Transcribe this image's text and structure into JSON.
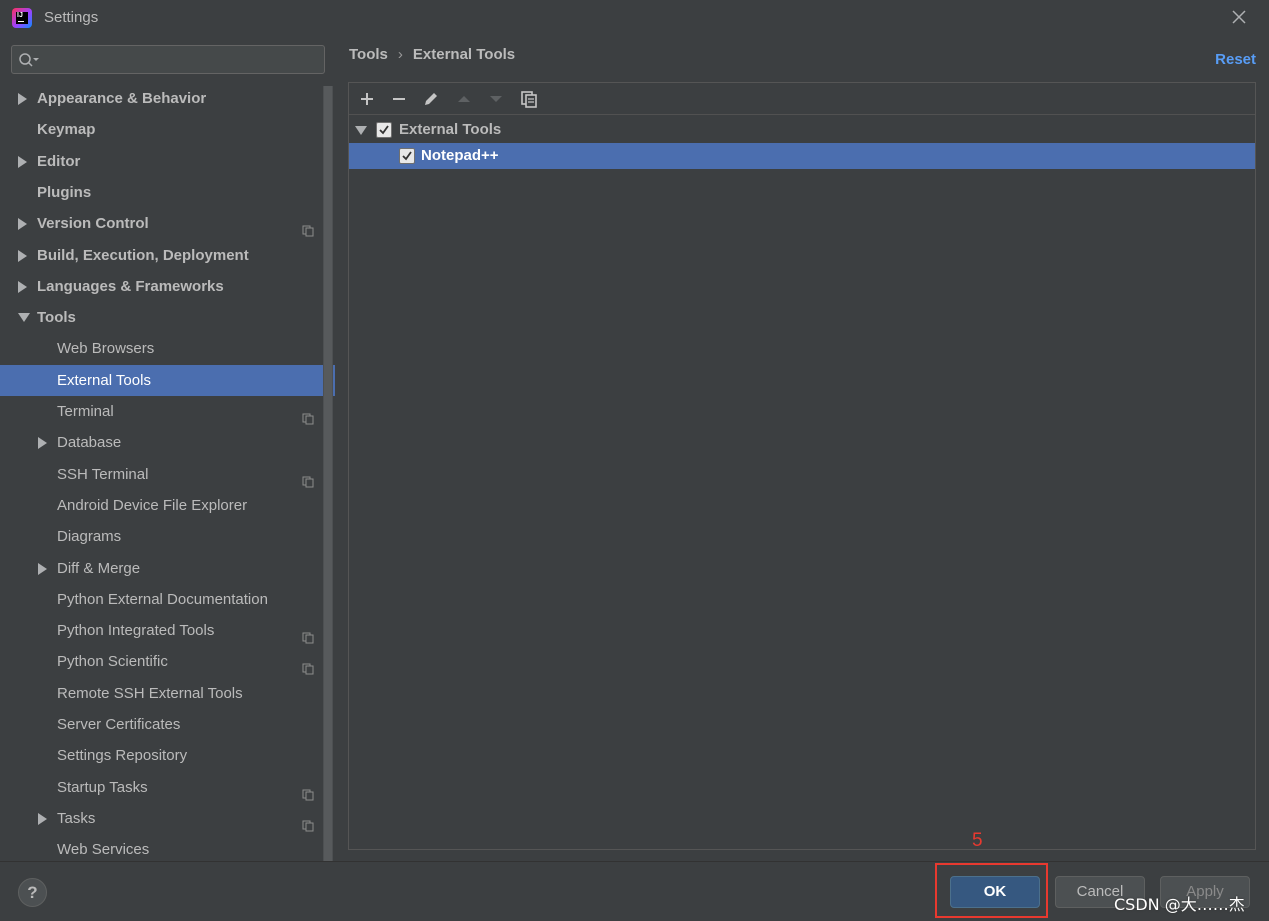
{
  "window": {
    "title": "Settings",
    "app_icon_text": "IJ"
  },
  "sidebar": {
    "search_placeholder": "",
    "items": [
      {
        "label": "Appearance & Behavior",
        "level": 0,
        "expandable": true,
        "expanded": false,
        "bold": true,
        "has_copy_icon": false
      },
      {
        "label": "Keymap",
        "level": 0,
        "expandable": false,
        "bold": true,
        "has_copy_icon": false
      },
      {
        "label": "Editor",
        "level": 0,
        "expandable": true,
        "expanded": false,
        "bold": true,
        "has_copy_icon": false
      },
      {
        "label": "Plugins",
        "level": 0,
        "expandable": false,
        "bold": true,
        "has_copy_icon": false
      },
      {
        "label": "Version Control",
        "level": 0,
        "expandable": true,
        "expanded": false,
        "bold": true,
        "has_copy_icon": true
      },
      {
        "label": "Build, Execution, Deployment",
        "level": 0,
        "expandable": true,
        "expanded": false,
        "bold": true,
        "has_copy_icon": false
      },
      {
        "label": "Languages & Frameworks",
        "level": 0,
        "expandable": true,
        "expanded": false,
        "bold": true,
        "has_copy_icon": false
      },
      {
        "label": "Tools",
        "level": 0,
        "expandable": true,
        "expanded": true,
        "bold": true,
        "has_copy_icon": false
      },
      {
        "label": "Web Browsers",
        "level": 1,
        "expandable": false,
        "has_copy_icon": false
      },
      {
        "label": "External Tools",
        "level": 1,
        "expandable": false,
        "selected": true,
        "has_copy_icon": false
      },
      {
        "label": "Terminal",
        "level": 1,
        "expandable": false,
        "has_copy_icon": true
      },
      {
        "label": "Database",
        "level": 1,
        "expandable": true,
        "expanded": false,
        "has_copy_icon": false
      },
      {
        "label": "SSH Terminal",
        "level": 1,
        "expandable": false,
        "has_copy_icon": true
      },
      {
        "label": "Android Device File Explorer",
        "level": 1,
        "expandable": false,
        "has_copy_icon": false
      },
      {
        "label": "Diagrams",
        "level": 1,
        "expandable": false,
        "has_copy_icon": false
      },
      {
        "label": "Diff & Merge",
        "level": 1,
        "expandable": true,
        "expanded": false,
        "has_copy_icon": false
      },
      {
        "label": "Python External Documentation",
        "level": 1,
        "expandable": false,
        "has_copy_icon": false
      },
      {
        "label": "Python Integrated Tools",
        "level": 1,
        "expandable": false,
        "has_copy_icon": true
      },
      {
        "label": "Python Scientific",
        "level": 1,
        "expandable": false,
        "has_copy_icon": true
      },
      {
        "label": "Remote SSH External Tools",
        "level": 1,
        "expandable": false,
        "has_copy_icon": false
      },
      {
        "label": "Server Certificates",
        "level": 1,
        "expandable": false,
        "has_copy_icon": false
      },
      {
        "label": "Settings Repository",
        "level": 1,
        "expandable": false,
        "has_copy_icon": false
      },
      {
        "label": "Startup Tasks",
        "level": 1,
        "expandable": false,
        "has_copy_icon": true
      },
      {
        "label": "Tasks",
        "level": 1,
        "expandable": true,
        "expanded": false,
        "has_copy_icon": true
      },
      {
        "label": "Web Services",
        "level": 1,
        "expandable": false,
        "has_copy_icon": false
      }
    ]
  },
  "header": {
    "breadcrumb": [
      "Tools",
      "External Tools"
    ],
    "breadcrumb_separator": "›",
    "reset_label": "Reset"
  },
  "toolbar": {
    "buttons": [
      "add-icon",
      "remove-icon",
      "edit-icon",
      "move-up-icon",
      "move-down-icon",
      "copy-icon"
    ]
  },
  "tools_tree": {
    "group": {
      "label": "External Tools",
      "checked": true,
      "expanded": true
    },
    "children": [
      {
        "label": "Notepad++",
        "checked": true,
        "selected": true
      }
    ]
  },
  "footer": {
    "help_label": "?",
    "ok_label": "OK",
    "cancel_label": "Cancel",
    "apply_label": "Apply"
  },
  "annotation": {
    "step_number": "5",
    "color": "#e8392f"
  },
  "watermark": "CSDN @大……杰",
  "colors": {
    "background": "#3c3f41",
    "selection": "#4b6eaf",
    "link": "#589df6",
    "ok_button": "#365880"
  }
}
